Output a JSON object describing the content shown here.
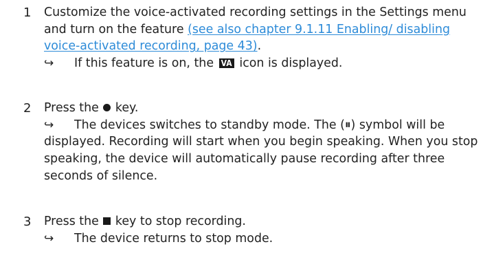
{
  "steps": [
    {
      "number": "1",
      "text_before_link": "Customize the voice-activated recording settings in the Settings menu and turn on the feature ",
      "link_text": "(see also chapter 9.1.11 Enabling/ disabling voice-activated recording, page 43)",
      "text_after_link": ".",
      "result_arrow": "↪",
      "result_before_icon": "If this feature is on, the ",
      "result_icon_label": "VA",
      "result_after_icon": " icon is displayed."
    },
    {
      "number": "2",
      "text_before_icon": "Press the ",
      "text_after_icon": " key.",
      "result_arrow": "↪",
      "result_text_before_symbol": "The devices switches to standby mode. The ",
      "result_symbol": "(⏸)",
      "result_text_after_symbol": " symbol will be displayed. Recording will start when you begin speaking. When you stop speaking, the device will automatically pause recording after three seconds of silence."
    },
    {
      "number": "3",
      "text_before_icon": "Press the ",
      "text_after_icon": " key to stop recording.",
      "result_arrow": "↪",
      "result_text": "The device returns to stop mode."
    }
  ],
  "icons": {
    "step2_key": "record-key-icon",
    "step3_key": "stop-key-icon"
  }
}
